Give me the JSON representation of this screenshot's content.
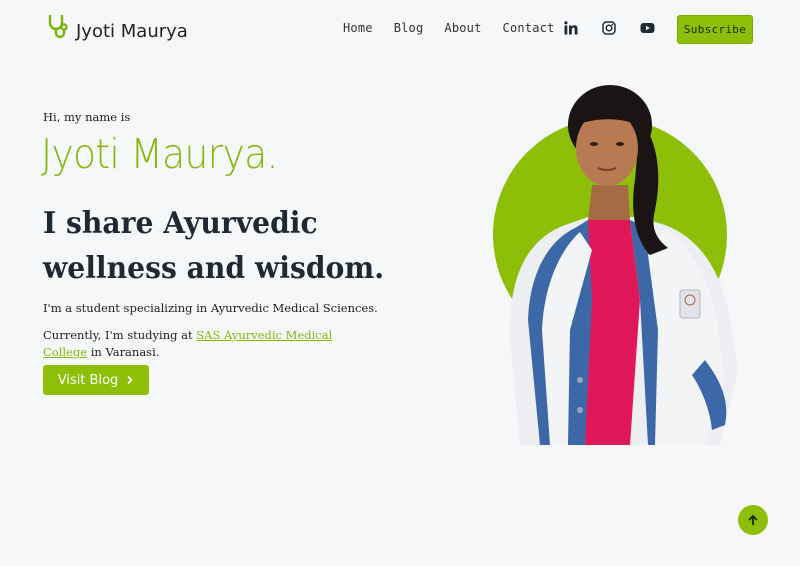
{
  "brand": {
    "name": "Jyoti Maurya",
    "icon": "stethoscope-icon"
  },
  "nav": {
    "items": [
      {
        "label": "Home"
      },
      {
        "label": "Blog"
      },
      {
        "label": "About"
      },
      {
        "label": "Contact"
      }
    ],
    "social": [
      {
        "icon": "linkedin-icon"
      },
      {
        "icon": "instagram-icon"
      },
      {
        "icon": "youtube-icon"
      }
    ],
    "subscribe_label": "Subscribe"
  },
  "hero": {
    "greeting": "Hi, my name is",
    "name": "Jyoti Maurya.",
    "tagline": "I share Ayurvedic wellness and wisdom.",
    "description_1": "I'm a student specializing in Ayurvedic Medical Sciences.",
    "description_2_prefix": "Currently, I'm studying at",
    "college_link": "SAS Ayurvedic Medical College",
    "description_2_suffix": "in Varanasi.",
    "button_label": "Visit Blog",
    "button_icon": "chevron-right-icon"
  },
  "scroll_top": {
    "icon": "arrow-up-icon"
  },
  "colors": {
    "accent": "#8dbf08",
    "accent_text": "#84b80b",
    "background": "#f6f7f9",
    "text": "#1f2933"
  }
}
